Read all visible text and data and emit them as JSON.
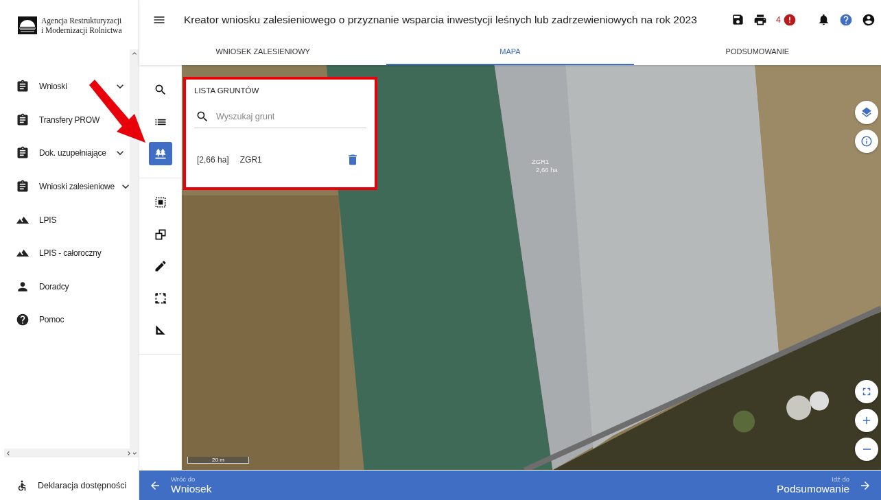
{
  "logo": {
    "line_1": "Agencja Restrukturyzacji",
    "line_2": "i Modernizacji Rolnictwa"
  },
  "sidebar": {
    "items": [
      {
        "label": "Wnioski",
        "kind": "clipboard",
        "expandable": true
      },
      {
        "label": "Transfery PROW",
        "kind": "clipboard",
        "expandable": false
      },
      {
        "label": "Dok. uzupełniające",
        "kind": "clipboard",
        "expandable": true
      },
      {
        "label": "Wnioski zalesieniowe",
        "kind": "clipboard",
        "expandable": true
      },
      {
        "label": "LPIS",
        "kind": "terrain",
        "expandable": false
      },
      {
        "label": "LPIS - całoroczny",
        "kind": "terrain",
        "expandable": false
      },
      {
        "label": "Doradcy",
        "kind": "person",
        "expandable": false
      },
      {
        "label": "Pomoc",
        "kind": "help",
        "expandable": false
      }
    ],
    "footer": {
      "label": "Deklaracja dostępności"
    }
  },
  "header": {
    "title": "Kreator wniosku zalesieniowego o przyznanie wsparcia inwestycji leśnych lub zadrzewieniowych na rok 2023",
    "alerts_count": "4"
  },
  "tabs": [
    {
      "label": "WNIOSEK ZALESIENIOWY",
      "selected": false
    },
    {
      "label": "MAPA",
      "selected": true
    },
    {
      "label": "PODSUMOWANIE",
      "selected": false
    }
  ],
  "tool_groups": [
    [
      {
        "kind": "search",
        "selected": false
      },
      {
        "kind": "list",
        "selected": false
      },
      {
        "kind": "trees",
        "selected": true
      }
    ],
    [
      {
        "kind": "select",
        "selected": false
      },
      {
        "kind": "copy",
        "selected": false
      },
      {
        "kind": "pencil",
        "selected": false
      },
      {
        "kind": "frame",
        "selected": false
      },
      {
        "kind": "ruler",
        "selected": false
      }
    ]
  ],
  "panel": {
    "title": "LISTA GRUNTÓW",
    "search": {
      "placeholder": "Wyszukaj grunt"
    },
    "items": [
      {
        "area": "[2,66 ha]",
        "name": "ZGR1"
      }
    ]
  },
  "map": {
    "labels": [
      {
        "name": "ZGR1",
        "area": "2,66 ha"
      }
    ],
    "scale": "20 m"
  },
  "footer": {
    "back": {
      "caption": "Wróć do",
      "label": "Wniosek"
    },
    "next": {
      "caption": "Idź do",
      "label": "Podsumowanie"
    }
  }
}
